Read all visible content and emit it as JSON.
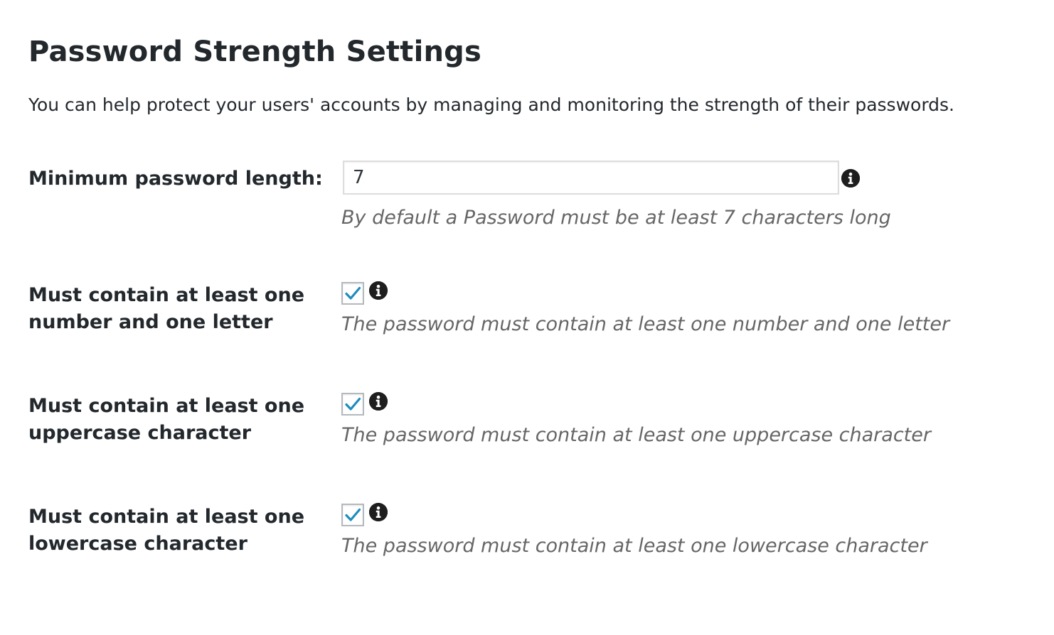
{
  "header": {
    "title": "Password Strength Settings",
    "description": "You can help protect your users' accounts by managing and monitoring the strength of their passwords."
  },
  "settings": [
    {
      "label": "Minimum password length:",
      "type": "text",
      "value": "7",
      "description": "By default a Password must be at least 7 characters long"
    },
    {
      "label": "Must contain at least one number and one letter",
      "type": "checkbox",
      "checked": true,
      "description": "The password must contain at least one number and one letter"
    },
    {
      "label": "Must contain at least one uppercase character",
      "type": "checkbox",
      "checked": true,
      "description": "The password must contain at least one uppercase character"
    },
    {
      "label": "Must contain at least one lowercase character",
      "type": "checkbox",
      "checked": true,
      "description": "The password must contain at least one lowercase character"
    }
  ],
  "icons": {
    "info": "info-icon",
    "check": "checkmark-icon"
  },
  "colors": {
    "checkmark": "#1e8cbe",
    "info_icon": "#1e1e1e",
    "description_text": "#666666",
    "heading_text": "#23282d"
  }
}
